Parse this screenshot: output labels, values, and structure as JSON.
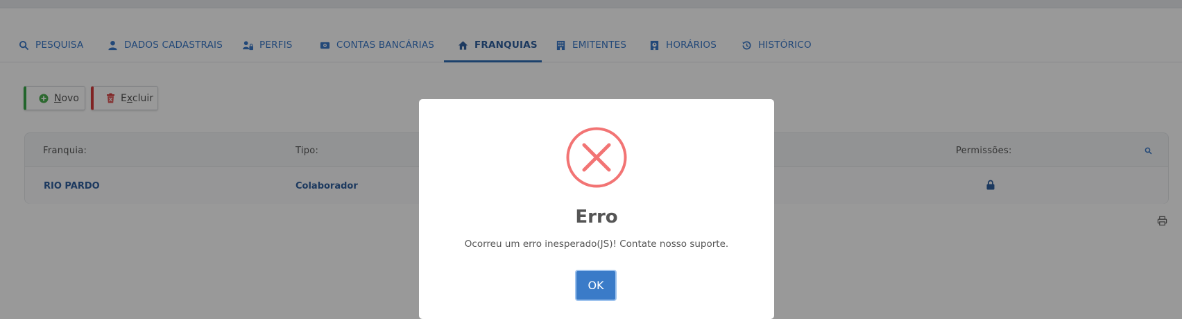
{
  "tabs": [
    {
      "label": "PESQUISA",
      "icon": "search-icon"
    },
    {
      "label": "DADOS CADASTRAIS",
      "icon": "user-icon"
    },
    {
      "label": "PERFIS",
      "icon": "users-lock-icon"
    },
    {
      "label": "CONTAS BANCÁRIAS",
      "icon": "bank-icon"
    },
    {
      "label": "FRANQUIAS",
      "icon": "home-icon"
    },
    {
      "label": "EMITENTES",
      "icon": "building-icon"
    },
    {
      "label": "HORÁRIOS",
      "icon": "clock-building-icon"
    },
    {
      "label": "HISTÓRICO",
      "icon": "history-icon"
    }
  ],
  "active_tab": "FRANQUIAS",
  "toolbar": {
    "novo_rest": "ovo",
    "novo_first": "N",
    "excluir_first": "E",
    "excluir_u": "x",
    "excluir_rest": "cluir"
  },
  "table": {
    "headers": [
      "Franquia:",
      "Tipo:",
      "Permissões:"
    ],
    "rows": [
      {
        "franquia": "RIO PARDO",
        "tipo": "Colaborador"
      }
    ]
  },
  "dialog": {
    "title": "Erro",
    "message": "Ocorreu um erro inesperado(JS)! Contate nosso suporte.",
    "ok_label": "OK"
  },
  "colors": {
    "accent": "#3a78c9",
    "error": "#f27474",
    "ok_button": "#3a7bc8",
    "novo_border": "#3aa84a",
    "excluir_border": "#d63b3b"
  }
}
